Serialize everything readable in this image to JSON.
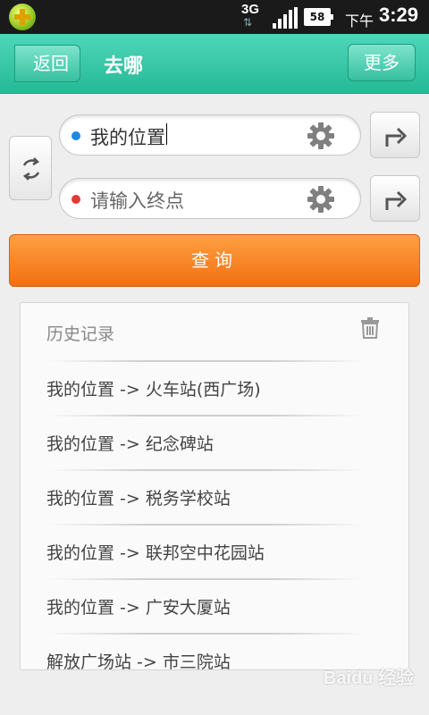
{
  "status_bar": {
    "network": "3G",
    "battery": "58",
    "ampm": "下午",
    "time": "3:29"
  },
  "header": {
    "back_label": "返回",
    "title": "去哪",
    "more_label": "更多"
  },
  "route": {
    "start": {
      "value": "我的位置",
      "dot_color": "#1e88e5"
    },
    "end": {
      "placeholder": "请输入终点",
      "dot_color": "#e53935"
    }
  },
  "query_button": {
    "label": "查询"
  },
  "history": {
    "title": "历史记录",
    "items": [
      "我的位置 -> 火车站(西广场)",
      "我的位置 -> 纪念碑站",
      "我的位置 -> 税务学校站",
      "我的位置 -> 联邦空中花园站",
      "我的位置 -> 广安大厦站",
      "解放广场站 -> 市三院站"
    ]
  },
  "colors": {
    "header": "#2fc3a2",
    "query_button": "#f7811f"
  },
  "watermark": "Baidu 经验"
}
